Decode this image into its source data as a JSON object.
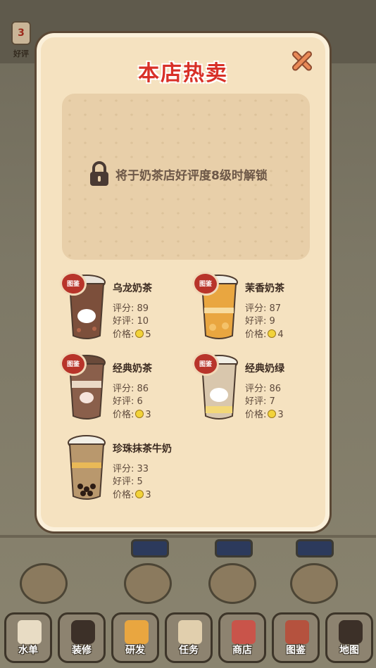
{
  "background": {
    "reputation_badge": {
      "level": "3",
      "label": "好评"
    }
  },
  "modal": {
    "title": "本店热卖",
    "close_icon": "close-x-icon",
    "locked_slot": {
      "text": "将于奶茶店好评度8级时解锁",
      "icon": "lock-icon"
    },
    "badge_text": "图鉴",
    "labels": {
      "score": "评分:",
      "reviews": "好评:",
      "price": "价格:"
    },
    "drinks": [
      {
        "name": "乌龙奶茶",
        "score": "89",
        "reviews": "10",
        "price": "5",
        "badge": true
      },
      {
        "name": "茉香奶茶",
        "score": "87",
        "reviews": "9",
        "price": "4",
        "badge": true
      },
      {
        "name": "经典奶茶",
        "score": "86",
        "reviews": "6",
        "price": "3",
        "badge": true
      },
      {
        "name": "经典奶绿",
        "score": "86",
        "reviews": "7",
        "price": "3",
        "badge": true
      },
      {
        "name": "珍珠抹茶牛奶",
        "score": "33",
        "reviews": "5",
        "price": "3",
        "badge": false
      }
    ]
  },
  "toolbar": {
    "items": [
      {
        "label": "水单",
        "icon": "menu-book-icon"
      },
      {
        "label": "装修",
        "icon": "lock-icon"
      },
      {
        "label": "研发",
        "icon": "cup-question-icon"
      },
      {
        "label": "任务",
        "icon": "clipboard-icon"
      },
      {
        "label": "商店",
        "icon": "shop-icon"
      },
      {
        "label": "图鉴",
        "icon": "album-icon"
      },
      {
        "label": "地图",
        "icon": "lock-icon"
      }
    ]
  },
  "colors": {
    "title": "#d83028",
    "panel": "#f5e2c0",
    "coin": "#f2d33a",
    "badge": "#b8342a"
  }
}
